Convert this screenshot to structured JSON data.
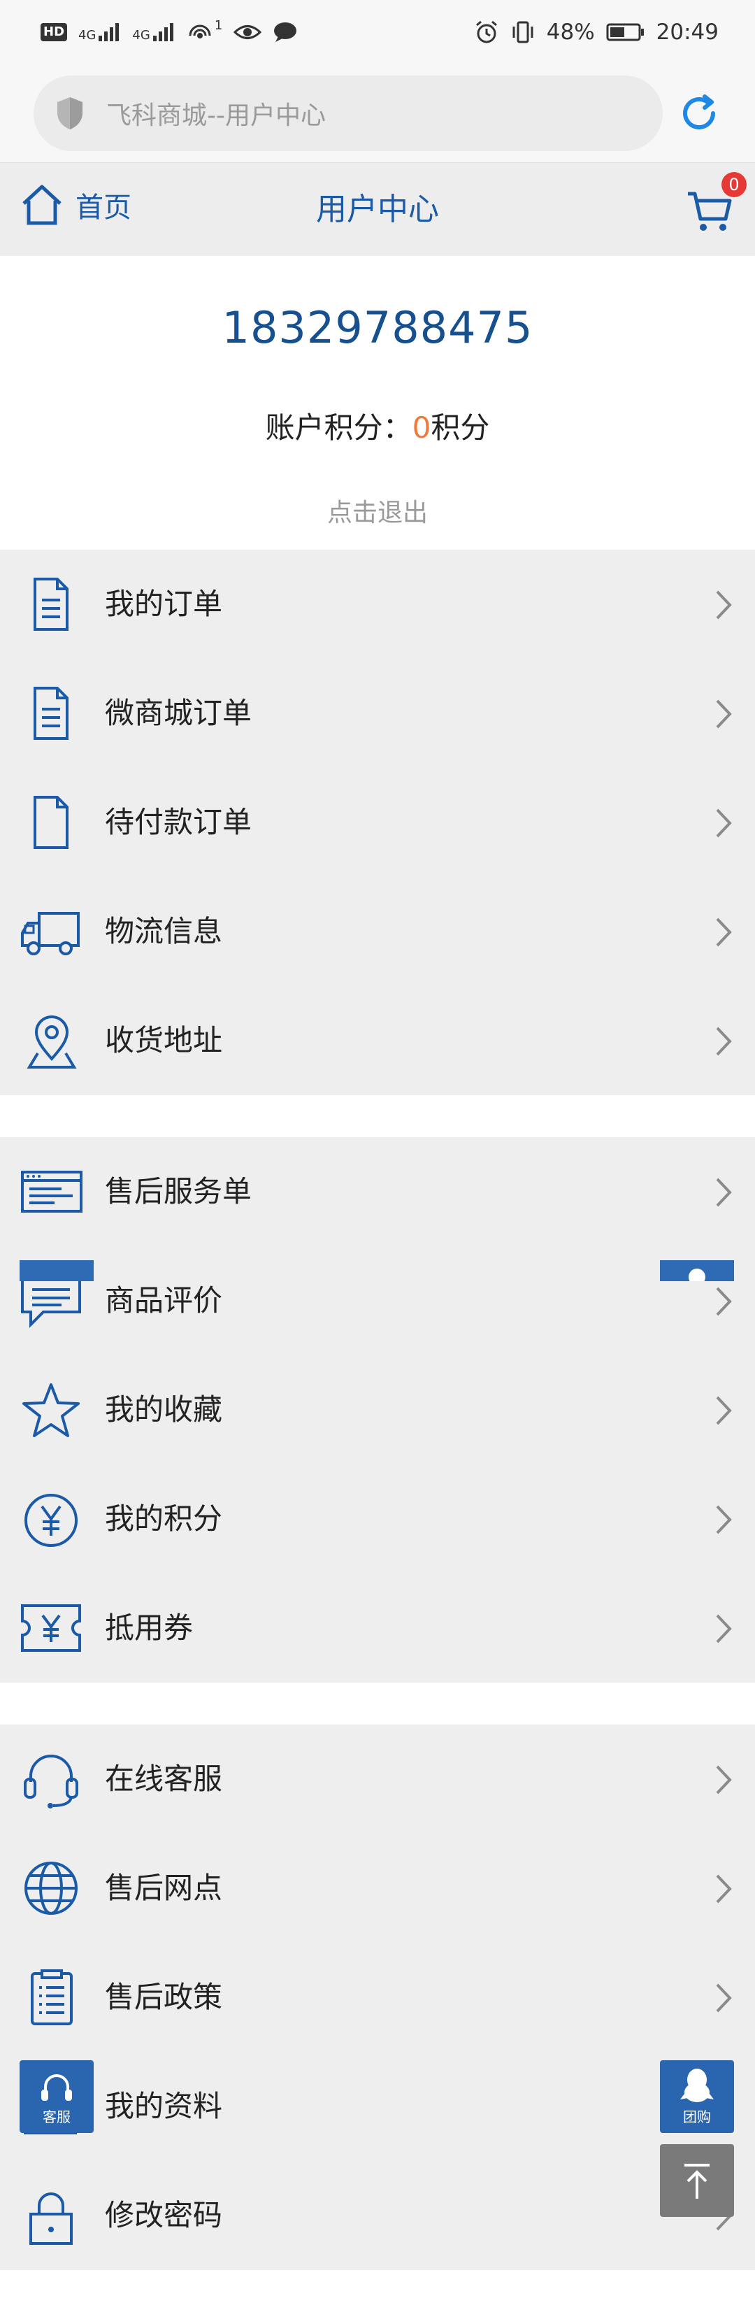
{
  "status": {
    "hd": "HD",
    "net1": "4G",
    "net2": "4G",
    "notif_count": "1",
    "battery": "48%",
    "time": "20:49"
  },
  "address": {
    "text": "飞科商城--用户中心"
  },
  "nav": {
    "home_label": "首页",
    "title": "用户中心",
    "cart_count": "0"
  },
  "profile": {
    "phone": "18329788475",
    "points_label": "账户积分：",
    "points_value": "0",
    "points_unit": "积分",
    "logout": "点击退出"
  },
  "groups": [
    {
      "items": [
        {
          "label": "我的订单",
          "icon": "document-icon"
        },
        {
          "label": "微商城订单",
          "icon": "document-icon"
        },
        {
          "label": "待付款订单",
          "icon": "blank-document-icon"
        },
        {
          "label": "物流信息",
          "icon": "truck-icon"
        },
        {
          "label": "收货地址",
          "icon": "location-pin-icon"
        }
      ]
    },
    {
      "items": [
        {
          "label": "售后服务单",
          "icon": "service-form-icon"
        },
        {
          "label": "商品评价",
          "icon": "comment-icon"
        },
        {
          "label": "我的收藏",
          "icon": "star-icon"
        },
        {
          "label": "我的积分",
          "icon": "yen-circle-icon"
        },
        {
          "label": "抵用券",
          "icon": "coupon-icon"
        }
      ]
    },
    {
      "items": [
        {
          "label": "在线客服",
          "icon": "headset-icon"
        },
        {
          "label": "售后网点",
          "icon": "globe-icon"
        },
        {
          "label": "售后政策",
          "icon": "clipboard-icon"
        },
        {
          "label": "我的资料",
          "icon": "profile-icon"
        },
        {
          "label": "修改密码",
          "icon": "lock-icon"
        }
      ]
    }
  ],
  "floating": {
    "service_label": "客服",
    "groupbuy_label": "团购"
  },
  "colors": {
    "brand_blue": "#1b5aa6",
    "accent_orange": "#f07a3c",
    "badge_red": "#e53935"
  }
}
